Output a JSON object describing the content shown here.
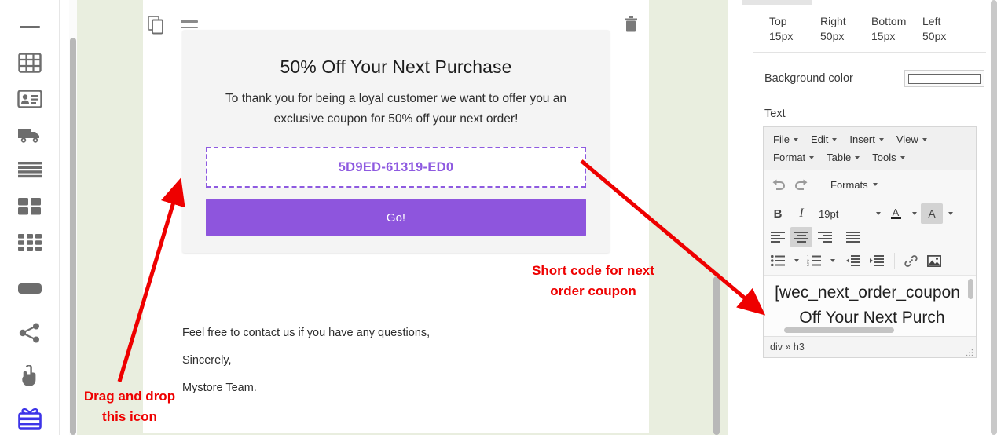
{
  "sidebar": {
    "items": [
      {
        "name": "divider-dash",
        "icon": "dash-icon",
        "label": ""
      },
      {
        "name": "table-block",
        "icon": "table-icon",
        "label": ""
      },
      {
        "name": "contact-card-block",
        "icon": "contact-card-icon",
        "label": ""
      },
      {
        "name": "shipping-block",
        "icon": "truck-icon",
        "label": ""
      },
      {
        "name": "text-lines-block",
        "icon": "text-lines-icon",
        "label": ""
      },
      {
        "name": "two-by-two-grid-block",
        "icon": "grid-2x2-icon",
        "label": ""
      },
      {
        "name": "three-by-three-grid-block",
        "icon": "grid-3x3-icon",
        "label": ""
      },
      {
        "name": "button-block",
        "icon": "button-pill-icon",
        "label": ""
      },
      {
        "name": "social-share-block",
        "icon": "share-icon",
        "label": ""
      },
      {
        "name": "click-action-block",
        "icon": "hand-click-icon",
        "label": ""
      },
      {
        "name": "coupon-block",
        "icon": "gift-card-icon",
        "label": ""
      }
    ]
  },
  "canvas": {
    "block_tools": {
      "copy_title": "Copy block",
      "drag_title": "Drag block",
      "delete_title": "Delete block"
    },
    "coupon": {
      "title": "50% Off Your Next Purchase",
      "description": "To thank you for being a loyal customer we want to offer you an exclusive coupon for 50% off your next order!",
      "code": "5D9ED-61319-ED0",
      "button_label": "Go!",
      "code_color": "#8e5ae0",
      "button_color": "#8e55dd"
    },
    "body": {
      "line1": "Feel free to contact us if you have any questions,",
      "line2": "Sincerely,",
      "line3": "Mystore Team."
    }
  },
  "annotations": {
    "color": "#ee0000",
    "shortcode_note": "Short code for next\norder coupon",
    "drag_note": "Drag and drop\nthis icon"
  },
  "settings_panel": {
    "spacing": [
      {
        "label": "Top",
        "value": "15px"
      },
      {
        "label": "Right",
        "value": "50px"
      },
      {
        "label": "Bottom",
        "value": "15px"
      },
      {
        "label": "Left",
        "value": "50px"
      }
    ],
    "background_color_label": "Background color",
    "background_color_value": "#ffffff",
    "text_label": "Text",
    "editor": {
      "menubar_row1": [
        "File",
        "Edit",
        "Insert",
        "View"
      ],
      "menubar_row2": [
        "Format",
        "Table",
        "Tools"
      ],
      "undo_title": "Undo",
      "redo_title": "Redo",
      "formats_label": "Formats",
      "bold_label": "B",
      "italic_label": "I",
      "font_size": "19pt",
      "text_color_label": "A",
      "background_color_label": "A",
      "align_left_title": "Align left",
      "align_center_title": "Align center",
      "align_right_title": "Align right",
      "align_justify_title": "Justify",
      "bullet_list_title": "Bullet list",
      "numbered_list_title": "Numbered list",
      "outdent_title": "Decrease indent",
      "indent_title": "Increase indent",
      "link_title": "Insert link",
      "image_title": "Insert image",
      "content_line1": "[wec_next_order_coupon",
      "content_line2": "Off Your Next Purch",
      "status_path": "div » h3"
    }
  }
}
